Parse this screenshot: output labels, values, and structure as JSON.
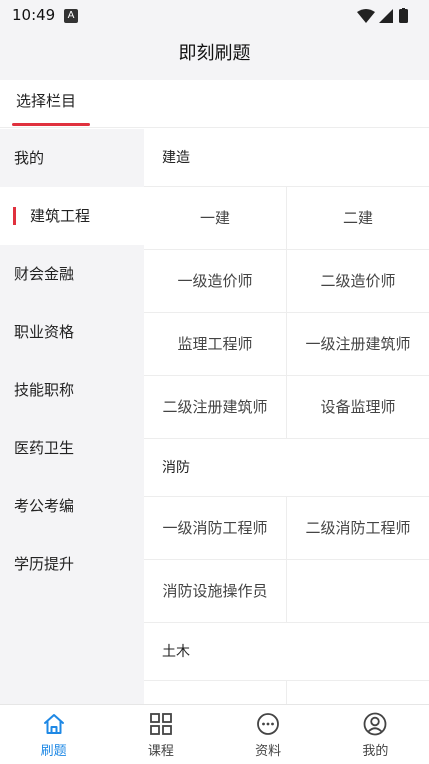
{
  "status_bar": {
    "time": "10:49",
    "notification_glyph": "A"
  },
  "header": {
    "title": "即刻刷题"
  },
  "tabs": {
    "active_label": "选择栏目",
    "accent_color": "#e0313e"
  },
  "sidebar": {
    "items": [
      {
        "label": "我的",
        "active": false
      },
      {
        "label": "建筑工程",
        "active": true
      },
      {
        "label": "财会金融",
        "active": false
      },
      {
        "label": "职业资格",
        "active": false
      },
      {
        "label": "技能职称",
        "active": false
      },
      {
        "label": "医药卫生",
        "active": false
      },
      {
        "label": "考公考编",
        "active": false
      },
      {
        "label": "学历提升",
        "active": false
      }
    ]
  },
  "content": {
    "sections": [
      {
        "title": "建造",
        "items": [
          "一建",
          "二建",
          "一级造价师",
          "二级造价师",
          "监理工程师",
          "一级注册建筑师",
          "二级注册建筑师",
          "设备监理师"
        ]
      },
      {
        "title": "消防",
        "items": [
          "一级消防工程师",
          "二级消防工程师",
          "消防设施操作员",
          ""
        ]
      },
      {
        "title": "土木",
        "items": []
      }
    ]
  },
  "bottom_nav": {
    "active_color": "#1e88e5",
    "items": [
      {
        "label": "刷题",
        "icon": "home-icon"
      },
      {
        "label": "课程",
        "icon": "grid-icon"
      },
      {
        "label": "资料",
        "icon": "chat-bubble-icon"
      },
      {
        "label": "我的",
        "icon": "user-icon"
      }
    ]
  }
}
